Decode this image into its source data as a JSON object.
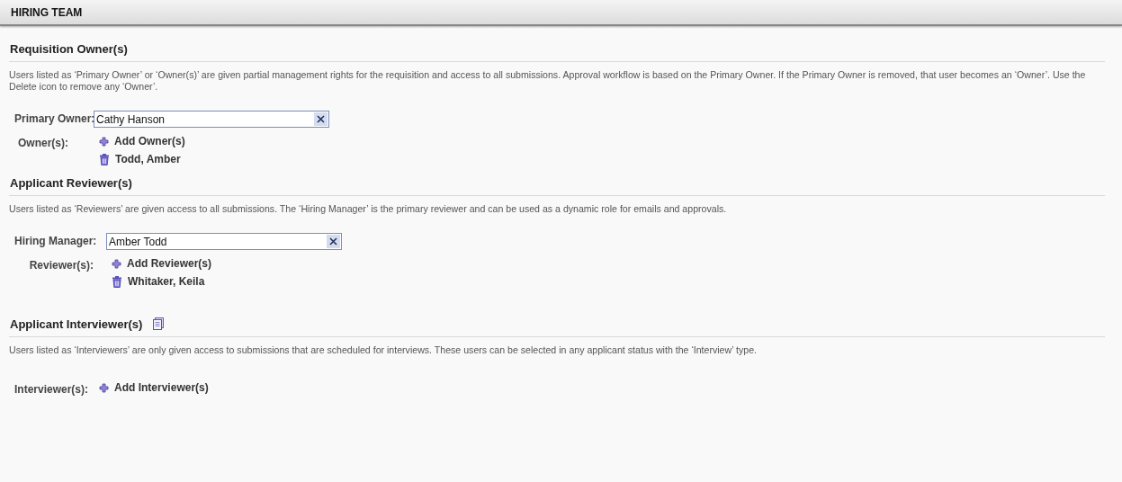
{
  "header": {
    "title": "HIRING TEAM"
  },
  "sections": [
    {
      "heading": "Requisition Owner(s)",
      "description": "Users listed as ‘Primary Owner’ or ‘Owner(s)’ are given partial management rights for the requisition and access to all submissions. Approval workflow is based on the Primary Owner. If the Primary Owner is removed, that user becomes an ‘Owner’. Use the Delete icon to remove any ‘Owner’.",
      "fields": [
        {
          "kind": "select",
          "label": "Primary Owner:",
          "value": "Cathy Hanson"
        },
        {
          "kind": "list",
          "label": "Owner(s):",
          "add_label": "Add Owner(s)",
          "entries": [
            "Todd, Amber"
          ]
        }
      ]
    },
    {
      "heading": "Applicant Reviewer(s)",
      "description": "Users listed as ‘Reviewers’ are given access to all submissions. The ‘Hiring Manager’ is the primary reviewer and can be used as a dynamic role for emails and approvals.",
      "fields": [
        {
          "kind": "select",
          "label": "Hiring Manager:",
          "value": "Amber Todd"
        },
        {
          "kind": "list",
          "label": "Reviewer(s):",
          "add_label": "Add Reviewer(s)",
          "entries": [
            "Whitaker, Keila"
          ]
        }
      ]
    },
    {
      "heading": "Applicant Interviewer(s)",
      "heading_icon": true,
      "description": "Users listed as ‘Interviewers’ are only given access to submissions that are scheduled for interviews. These users can be selected in any applicant status with the ‘Interview’ type.",
      "fields": [
        {
          "kind": "list",
          "label": "Interviewer(s):",
          "add_label": "Add Interviewer(s)"
        }
      ]
    }
  ]
}
